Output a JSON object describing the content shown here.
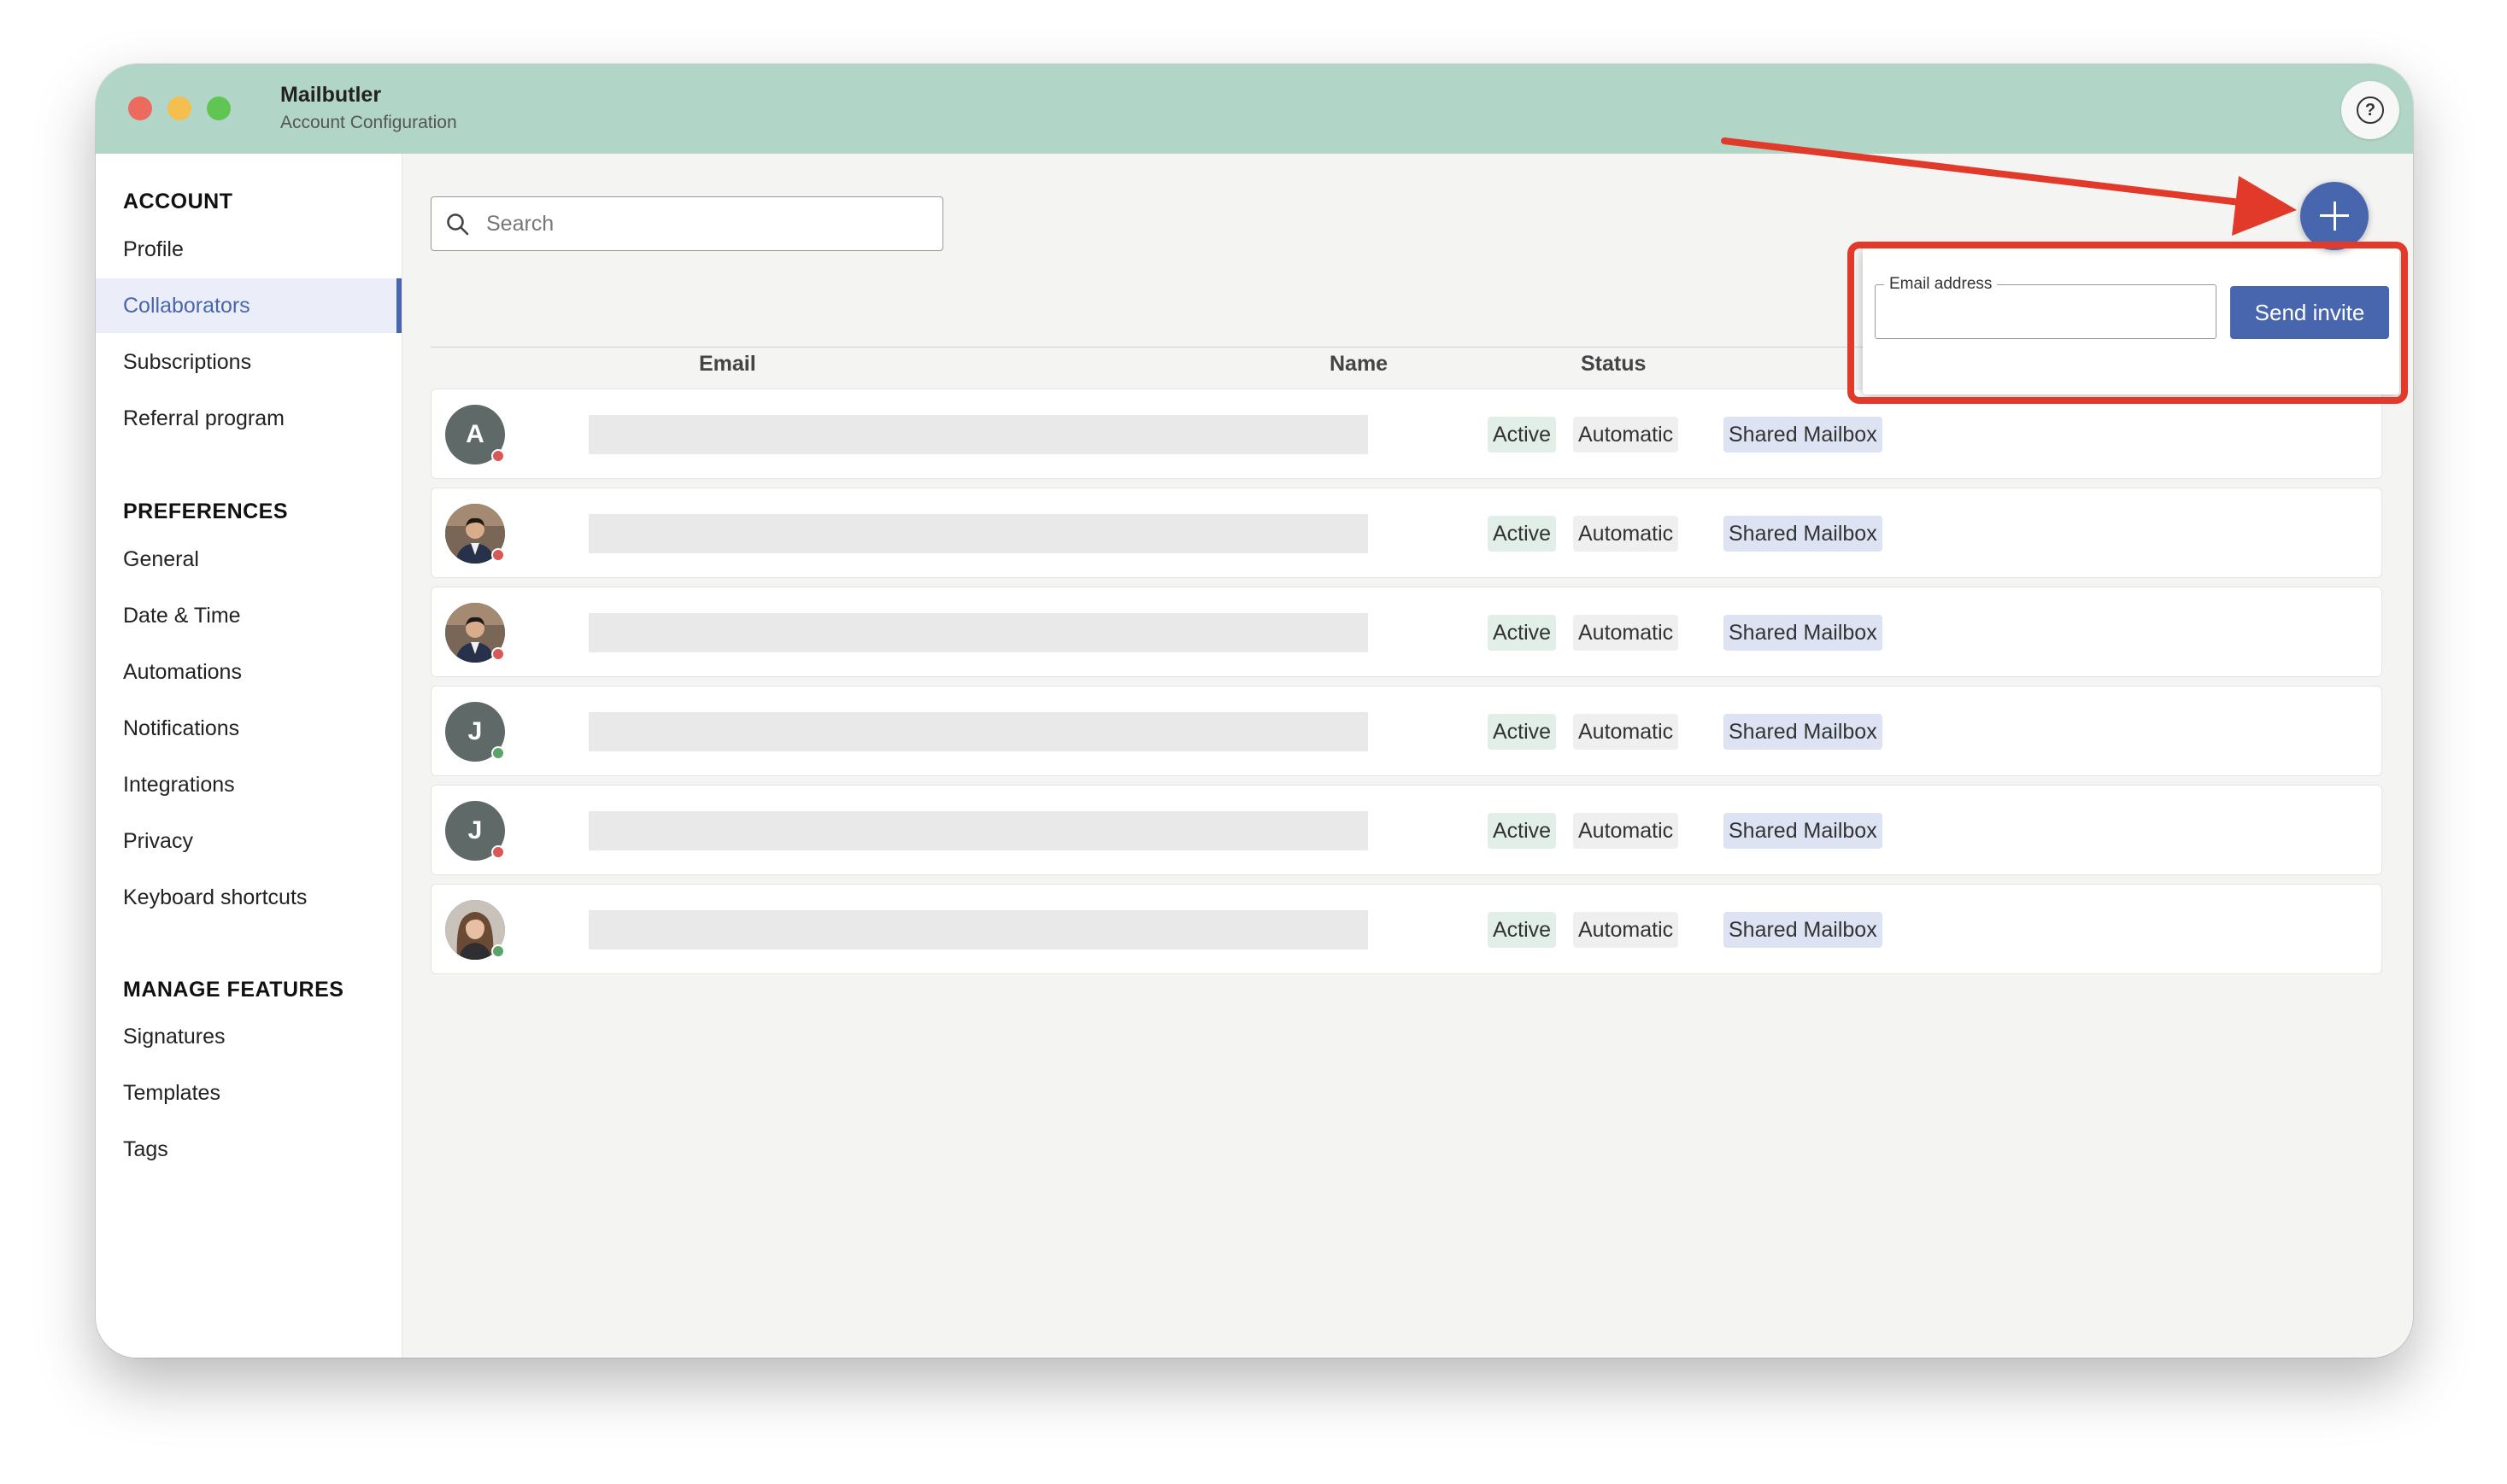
{
  "window": {
    "title": "Mailbutler",
    "subtitle": "Account Configuration"
  },
  "sidebar": {
    "sections": [
      {
        "title": "ACCOUNT",
        "items": [
          "Profile",
          "Collaborators",
          "Subscriptions",
          "Referral program"
        ]
      },
      {
        "title": "PREFERENCES",
        "items": [
          "General",
          "Date & Time",
          "Automations",
          "Notifications",
          "Integrations",
          "Privacy",
          "Keyboard shortcuts"
        ]
      },
      {
        "title": "MANAGE FEATURES",
        "items": [
          "Signatures",
          "Templates",
          "Tags"
        ]
      }
    ],
    "active_item": "Collaborators"
  },
  "search": {
    "placeholder": "Search"
  },
  "table": {
    "columns": [
      "Email",
      "Name",
      "Status"
    ],
    "rows": [
      {
        "avatar_initial": "A",
        "avatar_type": "initial",
        "presence": "offline",
        "tags": [
          "Active",
          "Automatic",
          "Shared Mailbox"
        ]
      },
      {
        "avatar_initial": "",
        "avatar_type": "photo-man",
        "presence": "offline",
        "tags": [
          "Active",
          "Automatic",
          "Shared Mailbox"
        ]
      },
      {
        "avatar_initial": "",
        "avatar_type": "photo-man",
        "presence": "offline",
        "tags": [
          "Active",
          "Automatic",
          "Shared Mailbox"
        ]
      },
      {
        "avatar_initial": "J",
        "avatar_type": "initial",
        "presence": "online",
        "tags": [
          "Active",
          "Automatic",
          "Shared Mailbox"
        ]
      },
      {
        "avatar_initial": "J",
        "avatar_type": "initial",
        "presence": "offline",
        "tags": [
          "Active",
          "Automatic",
          "Shared Mailbox"
        ]
      },
      {
        "avatar_initial": "",
        "avatar_type": "photo-woman",
        "presence": "online",
        "tags": [
          "Active",
          "Automatic",
          "Shared Mailbox"
        ]
      }
    ]
  },
  "invite_popover": {
    "email_label": "Email address",
    "email_value": "",
    "send_label": "Send invite"
  },
  "icons": {
    "help": "help-icon",
    "add": "plus-icon",
    "search": "search-icon"
  },
  "colors": {
    "titlebar": "#b1d6c8",
    "accent": "#4866ad",
    "annotation": "#e23a2a",
    "presence_online": "#5aa46a",
    "presence_offline": "#d85858"
  }
}
